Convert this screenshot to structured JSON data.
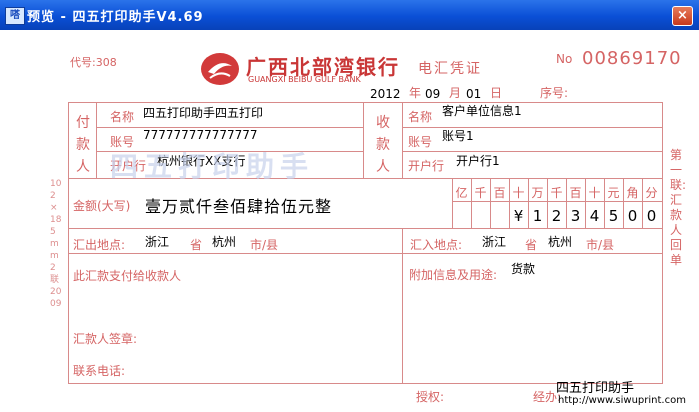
{
  "window": {
    "title": "预览 - 四五打印助手V4.69",
    "icon_label": "嗒",
    "close_label": "×"
  },
  "header": {
    "code": "代号:308",
    "bank_name_cn": "广西北部湾银行",
    "bank_name_en": "GUANGXI BEIBU GULF BANK",
    "voucher_type": "电汇凭证",
    "no_label": "No",
    "no_value": "00869170",
    "year": "2012",
    "month": "09",
    "day": "01",
    "year_unit": "年",
    "month_unit": "月",
    "day_unit": "日",
    "seq_label": "序号:"
  },
  "payer": {
    "section_label": "付款人",
    "name_label": "名称",
    "name_value": "四五打印助手四五打印",
    "account_label": "账号",
    "account_value": "777777777777777",
    "bank_label": "开户行",
    "bank_value": "杭州银行XX支行"
  },
  "payee": {
    "section_label": "收款人",
    "name_label": "名称",
    "name_value": "客户单位信息1",
    "account_label": "账号",
    "account_value": "账号1",
    "bank_label": "开户行",
    "bank_value": "开户行1"
  },
  "amount": {
    "label": "金额(大写)",
    "words": "壹万贰仟叁佰肆拾伍元整",
    "digit_headers": [
      "亿",
      "千",
      "百",
      "十",
      "万",
      "千",
      "百",
      "十",
      "元",
      "角",
      "分"
    ],
    "digits": [
      "",
      "",
      "",
      "¥",
      "1",
      "2",
      "3",
      "4",
      "5",
      "0",
      "0"
    ]
  },
  "remit_from": {
    "label": "汇出地点:",
    "province": "浙江",
    "province_unit": "省",
    "city": "杭州",
    "city_unit": "市/县"
  },
  "remit_to": {
    "label": "汇入地点:",
    "province": "浙江",
    "province_unit": "省",
    "city": "杭州",
    "city_unit": "市/县"
  },
  "left_bottom": {
    "line1": "此汇款支付给收款人",
    "signature": "汇款人签章:",
    "phone": "联系电话:"
  },
  "right_bottom": {
    "label": "附加信息及用途:",
    "value": "货款",
    "auth": "授权:",
    "handler": "经办:"
  },
  "side": {
    "note": "第一联:汇款人回单",
    "left_margin": "102×185mm 2联 2009"
  },
  "watermark_text": "四五打印助手",
  "footer": {
    "brand": "四五打印助手",
    "url": "http://www.siwuprint.com"
  }
}
